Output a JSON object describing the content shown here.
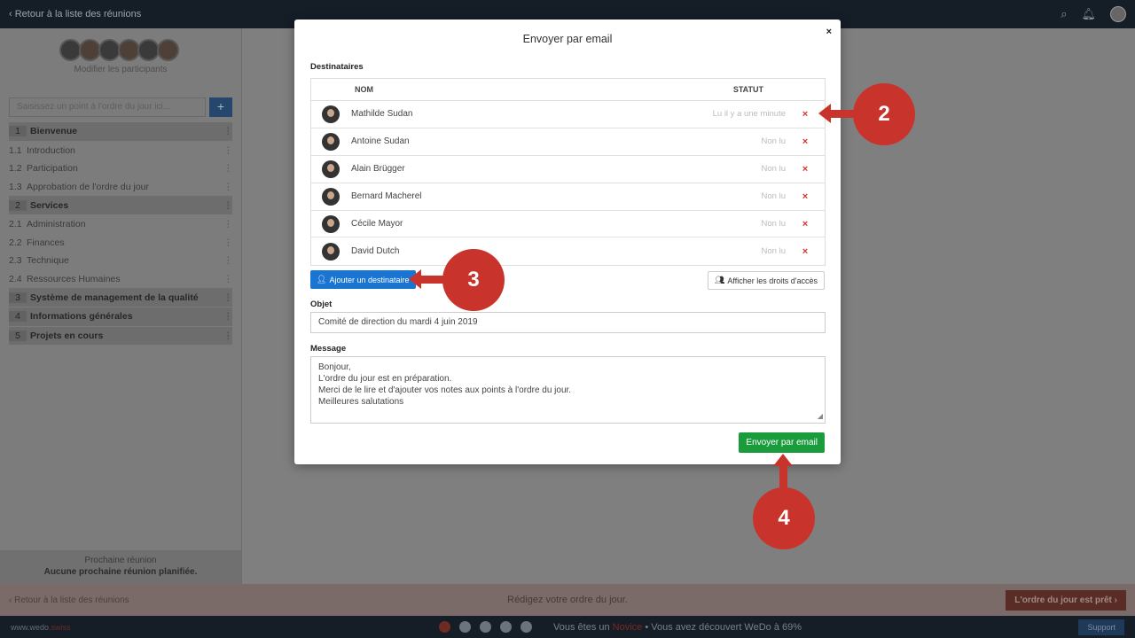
{
  "topbar": {
    "back_label": "‹ Retour à la liste des réunions"
  },
  "sidebar": {
    "modify_participants": "Modifier les participants",
    "agenda_placeholder": "Saisissez un point à l'ordre du jour ici...",
    "add_symbol": "+",
    "agenda": [
      {
        "num": "1",
        "label": "Bienvenue",
        "section": true
      },
      {
        "num": "1.1",
        "label": "Introduction",
        "section": false
      },
      {
        "num": "1.2",
        "label": "Participation",
        "section": false
      },
      {
        "num": "1.3",
        "label": "Approbation de l'ordre du jour",
        "section": false
      },
      {
        "num": "2",
        "label": "Services",
        "section": true
      },
      {
        "num": "2.1",
        "label": "Administration",
        "section": false
      },
      {
        "num": "2.2",
        "label": "Finances",
        "section": false
      },
      {
        "num": "2.3",
        "label": "Technique",
        "section": false
      },
      {
        "num": "2.4",
        "label": "Ressources Humaines",
        "section": false
      },
      {
        "num": "3",
        "label": "Système de management de la qualité",
        "section": true
      },
      {
        "num": "4",
        "label": "Informations générales",
        "section": true
      },
      {
        "num": "5",
        "label": "Projets en cours",
        "section": true
      }
    ],
    "next_meeting_title": "Prochaine réunion",
    "next_meeting_value": "Aucune prochaine réunion planifiée."
  },
  "bottom_bar": {
    "back_label": "‹ Retour à la liste des réunions",
    "center_text": "Rédigez votre ordre du jour.",
    "ready_label": "L'ordre du jour est prêt ›"
  },
  "footer": {
    "brand_www": "www.wedo",
    "brand_swiss": ".swiss",
    "level_prefix": "Vous êtes un ",
    "level_novice": "Novice",
    "level_suffix": " • Vous avez découvert WeDo à 69%",
    "support_label": "Support"
  },
  "modal": {
    "title": "Envoyer par email",
    "close": "×",
    "recipients_label": "Destinataires",
    "col_name": "NOM",
    "col_status": "STATUT",
    "recipients": [
      {
        "name": "Mathilde Sudan",
        "status": "Lu il y a une minute"
      },
      {
        "name": "Antoine Sudan",
        "status": "Non lu"
      },
      {
        "name": "Alain Brügger",
        "status": "Non lu"
      },
      {
        "name": "Bernard Macherel",
        "status": "Non lu"
      },
      {
        "name": "Cécile Mayor",
        "status": "Non lu"
      },
      {
        "name": "David Dutch",
        "status": "Non lu"
      }
    ],
    "remove_symbol": "×",
    "add_recipient": "Ajouter un destinataire",
    "show_rights": "Afficher les droits d'accès",
    "subject_label": "Objet",
    "subject_value": "Comité de direction du mardi 4 juin 2019",
    "message_label": "Message",
    "message_lines": [
      "Bonjour,",
      "L'ordre du jour est en préparation.",
      "Merci de le lire et d'ajouter vos notes aux points à l'ordre du jour.",
      "Meilleures salutations"
    ],
    "send_label": "Envoyer par email"
  },
  "callouts": {
    "c2": "2",
    "c3": "3",
    "c4": "4"
  }
}
